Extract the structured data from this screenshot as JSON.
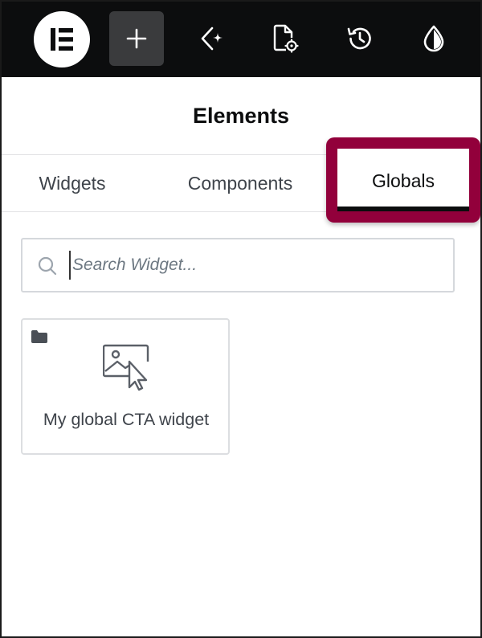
{
  "toolbar": {
    "items": [
      {
        "icon": "elementor-logo-icon",
        "label": ""
      },
      {
        "icon": "plus-icon",
        "label": ""
      },
      {
        "icon": "ai-sparkle-icon",
        "label": ""
      },
      {
        "icon": "page-settings-icon",
        "label": ""
      },
      {
        "icon": "history-icon",
        "label": ""
      },
      {
        "icon": "site-settings-drop-icon",
        "label": ""
      }
    ]
  },
  "panel": {
    "title": "Elements"
  },
  "tabs": [
    {
      "label": "Widgets",
      "active": false
    },
    {
      "label": "Components",
      "active": false
    },
    {
      "label": "Globals",
      "active": true
    }
  ],
  "highlight_color": "#92003b",
  "search": {
    "placeholder": "Search Widget...",
    "value": ""
  },
  "widgets": [
    {
      "label": "My global CTA widget",
      "icon": "image-cursor-icon",
      "badge_icon": "folder-icon"
    }
  ]
}
